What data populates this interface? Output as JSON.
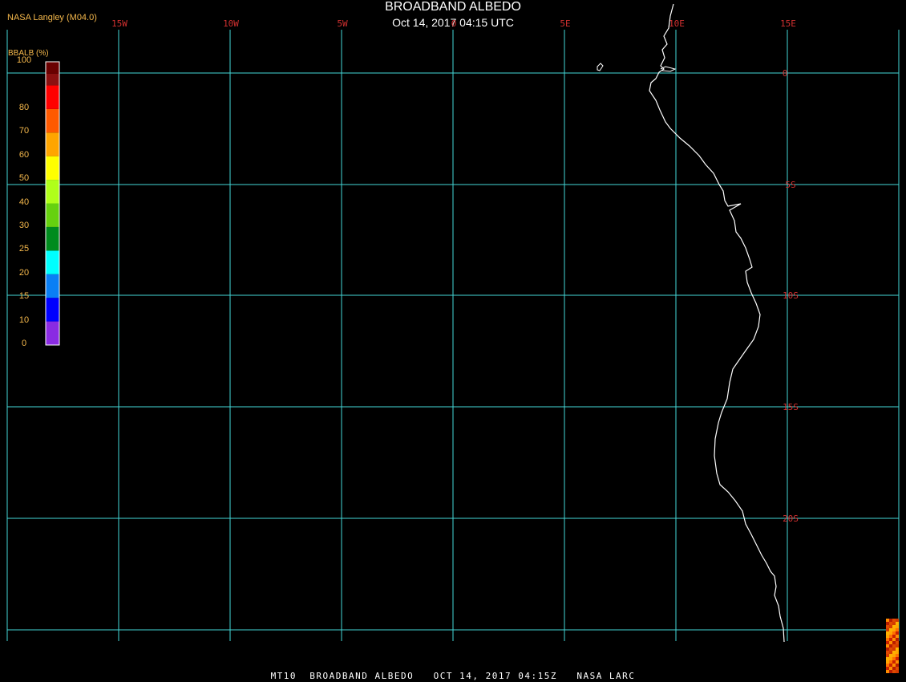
{
  "header": {
    "title": "BROADBAND ALBEDO",
    "subtitle": "Oct 14, 2017 04:15 UTC",
    "producer": "NASA Langley (M04.0)"
  },
  "footer": "MT10  BROADBAND ALBEDO   OCT 14, 2017 04:15Z   NASA LARC",
  "colorbar": {
    "title": "BBALB (%)",
    "tick_labels": [
      "0",
      "10",
      "15",
      "20",
      "25",
      "30",
      "40",
      "50",
      "60",
      "70",
      "80",
      "100"
    ],
    "segment_colors": [
      "#8a2be2",
      "#0000ff",
      "#0a7ff5",
      "#00ffff",
      "#008b1e",
      "#66d10f",
      "#b0ff1a",
      "#ffff00",
      "#ffa500",
      "#ff5a00",
      "#ff0000",
      "#8b1010",
      "#6a0000"
    ]
  },
  "map": {
    "lon_labels": [
      "15W",
      "10W",
      "5W",
      "0",
      "5E",
      "10E",
      "15E"
    ],
    "lat_labels": [
      "0",
      "5S",
      "10S",
      "15S",
      "20S"
    ],
    "grid_color": "#45d7d7",
    "label_color": "#d23030",
    "coastline_color": "#ffffff"
  }
}
